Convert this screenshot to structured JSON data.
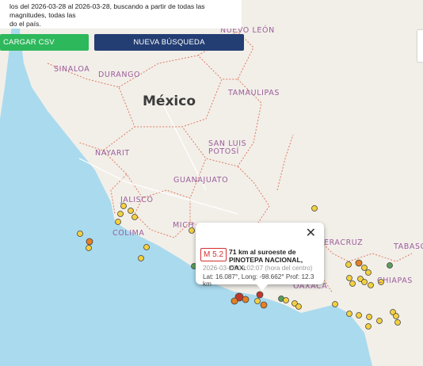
{
  "header": {
    "info_line1": "los del 2026-03-28 al 2026-03-28, buscando a partir de todas las magnitudes, todas las",
    "info_line2": "do el país."
  },
  "buttons": {
    "download_csv": "CARGAR CSV",
    "new_search": "NUEVA BÚSQUEDA"
  },
  "map": {
    "country_label": "México",
    "place_labels": {
      "sinaloa": "SINALOA",
      "durango": "DURANGO",
      "tamaulipas": "TAMAULIPAS",
      "nuevo_leon": "NUEVO LEÓN",
      "nayarit": "NAYARIT",
      "san_luis_potosi_1": "SAN LUIS",
      "san_luis_potosi_2": "POTOSÍ",
      "guanajuato": "GUANAJUATO",
      "jalisco": "JALISCO",
      "colima": "COLIMA",
      "michoacan": "MICH",
      "veracruz": "ERACRUZ",
      "tabasco": "TABASCO",
      "chiapas": "CHIAPAS",
      "oaxaca": "OAXACA"
    }
  },
  "popup": {
    "magnitude": "M 5.2",
    "place_line1": "71 km al suroeste de",
    "place_line2": "PINOTEPA NACIONAL, OAX.",
    "datetime": "2026-03-28   09:02:07 (hora del centro)",
    "coords": "Lat: 16.087°, Long: -98.662° Prof: 12.3 km",
    "close_icon": "close-icon"
  },
  "colors": {
    "sea": "#aadaee",
    "land": "#f2efe9",
    "state_border": "#e07a5f",
    "csv_button": "#2eb85c",
    "new_search_button": "#233e73",
    "quake_yellow": "#f4d03f",
    "quake_orange": "#e67e22",
    "quake_red": "#c0392b",
    "quake_green": "#5a9e5a"
  }
}
